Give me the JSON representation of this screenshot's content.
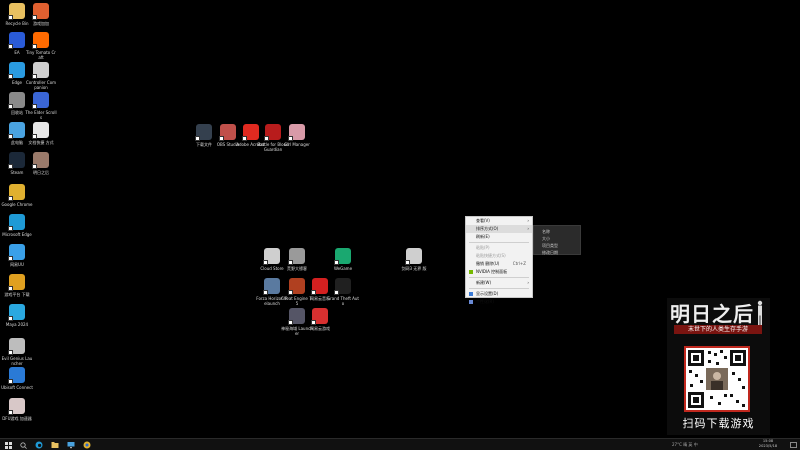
{
  "desktop_icons": [
    {
      "label": "Recycle Bin",
      "icon": "recycle-bin-icon",
      "color": "#e8c060"
    },
    {
      "label": "游戏加加",
      "icon": "game-app-icon",
      "color": "#e06030"
    },
    {
      "label": "EA",
      "icon": "ea-app-icon",
      "color": "#2a5bd7"
    },
    {
      "label": "Tiny Tomato\nCraft",
      "icon": "tomato-app-icon",
      "color": "#ff6a00"
    },
    {
      "label": "Edge",
      "icon": "bird-app-icon",
      "color": "#2a9be0"
    },
    {
      "label": "Controller\nCompanion",
      "icon": "gamepad-icon",
      "color": "#cfcfcf"
    },
    {
      "label": "回收站",
      "icon": "trash-icon",
      "color": "#8a8a8a"
    },
    {
      "label": "The Elder\nScrolls",
      "icon": "music-app-icon",
      "color": "#3a66d6"
    },
    {
      "label": "此电脑",
      "icon": "computer-icon",
      "color": "#4aa3e0"
    },
    {
      "label": "文档快捷\n方式",
      "icon": "document-icon",
      "color": "#e6e6e6"
    },
    {
      "label": "Steam",
      "icon": "steam-icon",
      "color": "#1b2838"
    },
    {
      "label": "明日之后",
      "icon": "game-character-icon",
      "color": "#9a7a6a"
    },
    {
      "label": "Google Chrome",
      "icon": "chrome-icon",
      "color": "#e0b030"
    },
    {
      "label": "Microsoft\nEdge",
      "icon": "edge-icon",
      "color": "#1f9ad6"
    },
    {
      "label": "网易UU",
      "icon": "uu-icon",
      "color": "#3aa0e8"
    },
    {
      "label": "游戏平台\n下载",
      "icon": "platform-icon",
      "color": "#e0a020"
    },
    {
      "label": "Maya 2024",
      "icon": "maya-icon",
      "color": "#2aa8e0"
    },
    {
      "label": "Evil Genius\nLauncher",
      "icon": "qr-like-icon",
      "color": "#bdbdbd"
    },
    {
      "label": "Ubisoft\nConnect",
      "icon": "ubisoft-icon",
      "color": "#2a7ad6"
    },
    {
      "label": "DFU游戏\n加速器",
      "icon": "anime-girl-icon",
      "color": "#d8c8c8"
    }
  ],
  "center_icons": [
    {
      "label": "下载文件",
      "icon": "dark-game-icon",
      "color": "#34404e"
    },
    {
      "label": "OBS Studio",
      "icon": "obs-icon",
      "color": "#c0504a"
    },
    {
      "label": "Adobe Acrobat",
      "icon": "acrobat-icon",
      "color": "#e02a20"
    },
    {
      "label": "Battle for\nBlood Guardian",
      "icon": "red-logo-icon",
      "color": "#b81c1c"
    },
    {
      "label": "Girl Manager",
      "icon": "anime-portrait-icon",
      "color": "#d89aa8"
    },
    {
      "label": "Cloud Store",
      "icon": "cloud-app-icon",
      "color": "#cfcfcf"
    },
    {
      "label": "荒野大镖客",
      "icon": "crossed-swords-icon",
      "color": "#9a9a9a"
    },
    {
      "label": "WeGame",
      "icon": "wegame-icon",
      "color": "#1aa870"
    },
    {
      "label": "剑网3 无界\n版",
      "icon": "x-logo-icon",
      "color": "#cfcfcf"
    },
    {
      "label": "Forza Horizon\nRelaunch",
      "icon": "round-game-icon",
      "color": "#5a7aa0"
    },
    {
      "label": "Cheat Engine\n7.5",
      "icon": "ce-icon",
      "color": "#b04020"
    },
    {
      "label": "网易云音乐",
      "icon": "red-square-icon",
      "color": "#d42020"
    },
    {
      "label": "Grand Theft\nAuto",
      "icon": "dark-circle-icon",
      "color": "#202020"
    },
    {
      "label": "神秘海域\nLauncher",
      "icon": "dark-swords-icon",
      "color": "#556"
    },
    {
      "label": "网易云游戏",
      "icon": "red-cloud-icon",
      "color": "#d83030"
    }
  ],
  "context_menu": {
    "items": [
      {
        "label": "查看(V)",
        "type": "submenu",
        "dim": false
      },
      {
        "label": "排序方式(O)",
        "type": "submenu",
        "dim": false,
        "highlight": true
      },
      {
        "label": "刷新(E)",
        "type": "item",
        "dim": false
      },
      {
        "sep": true
      },
      {
        "label": "粘贴(P)",
        "type": "item",
        "dim": true
      },
      {
        "label": "粘贴快捷方式(S)",
        "type": "item",
        "dim": true
      },
      {
        "label": "撤销 删除(U)",
        "type": "item",
        "dim": false,
        "shortcut": "Ctrl+Z"
      },
      {
        "label": "NVIDIA 控制面板",
        "type": "item",
        "dim": false,
        "icon": "nvidia-icon"
      },
      {
        "sep": true
      },
      {
        "label": "新建(W)",
        "type": "submenu",
        "dim": false
      },
      {
        "sep": true
      },
      {
        "label": "显示设置(D)",
        "type": "item",
        "dim": false,
        "icon": "display-icon"
      },
      {
        "label": "个性化(R)",
        "type": "item",
        "dim": false,
        "icon": "personalize-icon"
      }
    ],
    "submenu": [
      "名称",
      "大小",
      "项目类型",
      "修改日期"
    ]
  },
  "ad": {
    "title": "明日之后",
    "subtitle": "末世下的人类生存手游",
    "cta": "扫码下载游戏",
    "accent": "#c0281e"
  },
  "taskbar": {
    "tray_info": "27°C  晴  英  中",
    "time": "15:08",
    "date": "2023/5/18"
  }
}
